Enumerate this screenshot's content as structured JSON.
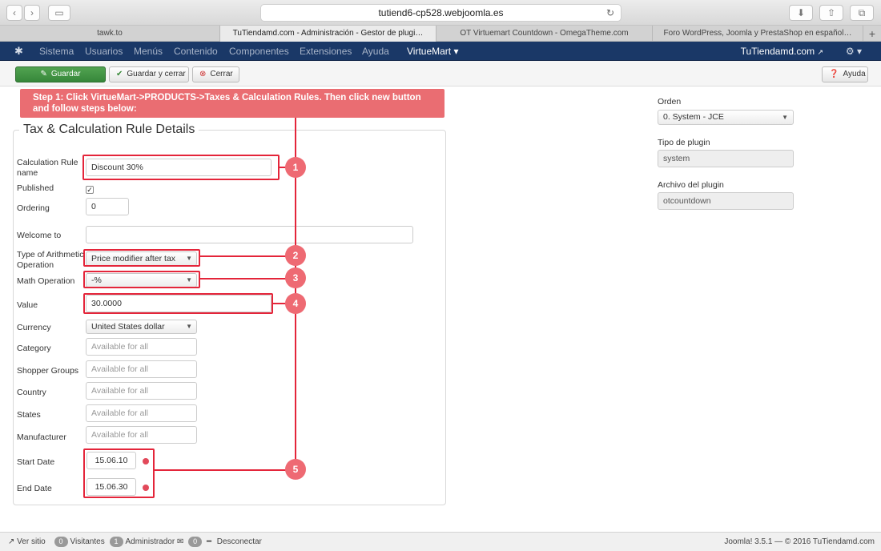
{
  "browser": {
    "url": "tutiend6-cp528.webjoomla.es",
    "tabs": [
      "tawk.to",
      "TuTiendamd.com - Administración - Gestor de plugi…",
      "OT Virtuemart Countdown - OmegaTheme.com",
      "Foro WordPress, Joomla y PrestaShop en español…"
    ]
  },
  "navbar": {
    "items": [
      "Sistema",
      "Usuarios",
      "Menús",
      "Contenido",
      "Componentes",
      "Extensiones",
      "Ayuda"
    ],
    "virtuemart": "VirtueMart",
    "site": "TuTiendamd.com"
  },
  "toolbar": {
    "save": "Guardar",
    "save_close": "Guardar y cerrar",
    "close": "Cerrar",
    "help": "Ayuda"
  },
  "banner": "Step 1: Click VirtueMart->PRODUCTS->Taxes & Calculation Rules. Then click new button and follow steps below:",
  "form": {
    "legend": "Tax & Calculation Rule Details",
    "labels": {
      "name": "Calculation Rule name",
      "published": "Published",
      "ordering": "Ordering",
      "welcome": "Welcome to",
      "arith": "Type of Arithmetic Operation",
      "math": "Math Operation",
      "value": "Value",
      "currency": "Currency",
      "category": "Category",
      "shopper": "Shopper Groups",
      "country": "Country",
      "states": "States",
      "manufacturer": "Manufacturer",
      "start": "Start Date",
      "end": "End Date"
    },
    "values": {
      "name": "Discount 30%",
      "published": true,
      "ordering": "0",
      "welcome": "",
      "arith": "Price modifier after tax",
      "math": "-%",
      "value": "30.0000",
      "currency": "United States dollar",
      "start": "15.06.10",
      "end": "15.06.30"
    },
    "placeholder": "Available for all"
  },
  "steps": [
    "1",
    "2",
    "3",
    "4",
    "5"
  ],
  "right": {
    "orden_label": "Orden",
    "orden_value": "0. System - JCE",
    "tipo_label": "Tipo de plugin",
    "tipo_value": "system",
    "archivo_label": "Archivo del plugin",
    "archivo_value": "otcountdown"
  },
  "footer": {
    "ver_sitio": "Ver sitio",
    "visitantes_count": "0",
    "visitantes": "Visitantes",
    "admin_count": "1",
    "admin": "Administrador",
    "msg_count": "0",
    "desconectar": "Desconectar",
    "version": "Joomla! 3.5.1 — © 2016 TuTiendamd.com"
  },
  "colors": {
    "navbar": "#1a3867",
    "annotation": "#e4253a",
    "badge": "#ee6a73",
    "save": "#46a046"
  }
}
